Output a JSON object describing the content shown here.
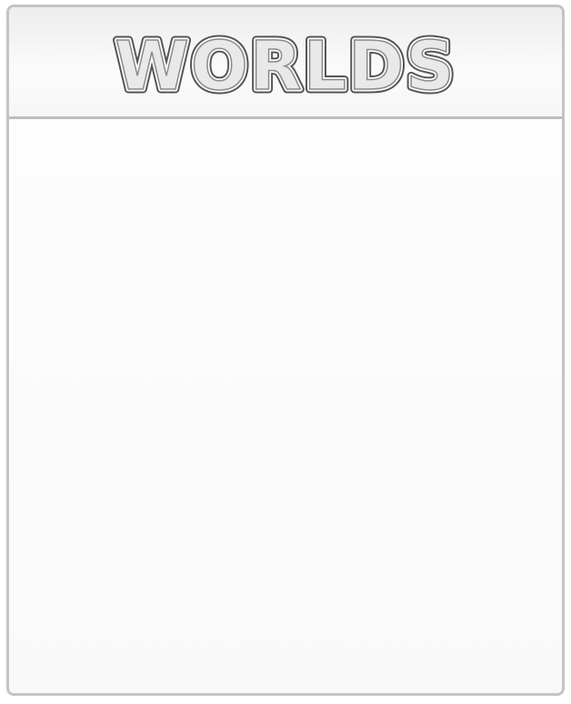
{
  "panel": {
    "title": "WORLDS"
  }
}
